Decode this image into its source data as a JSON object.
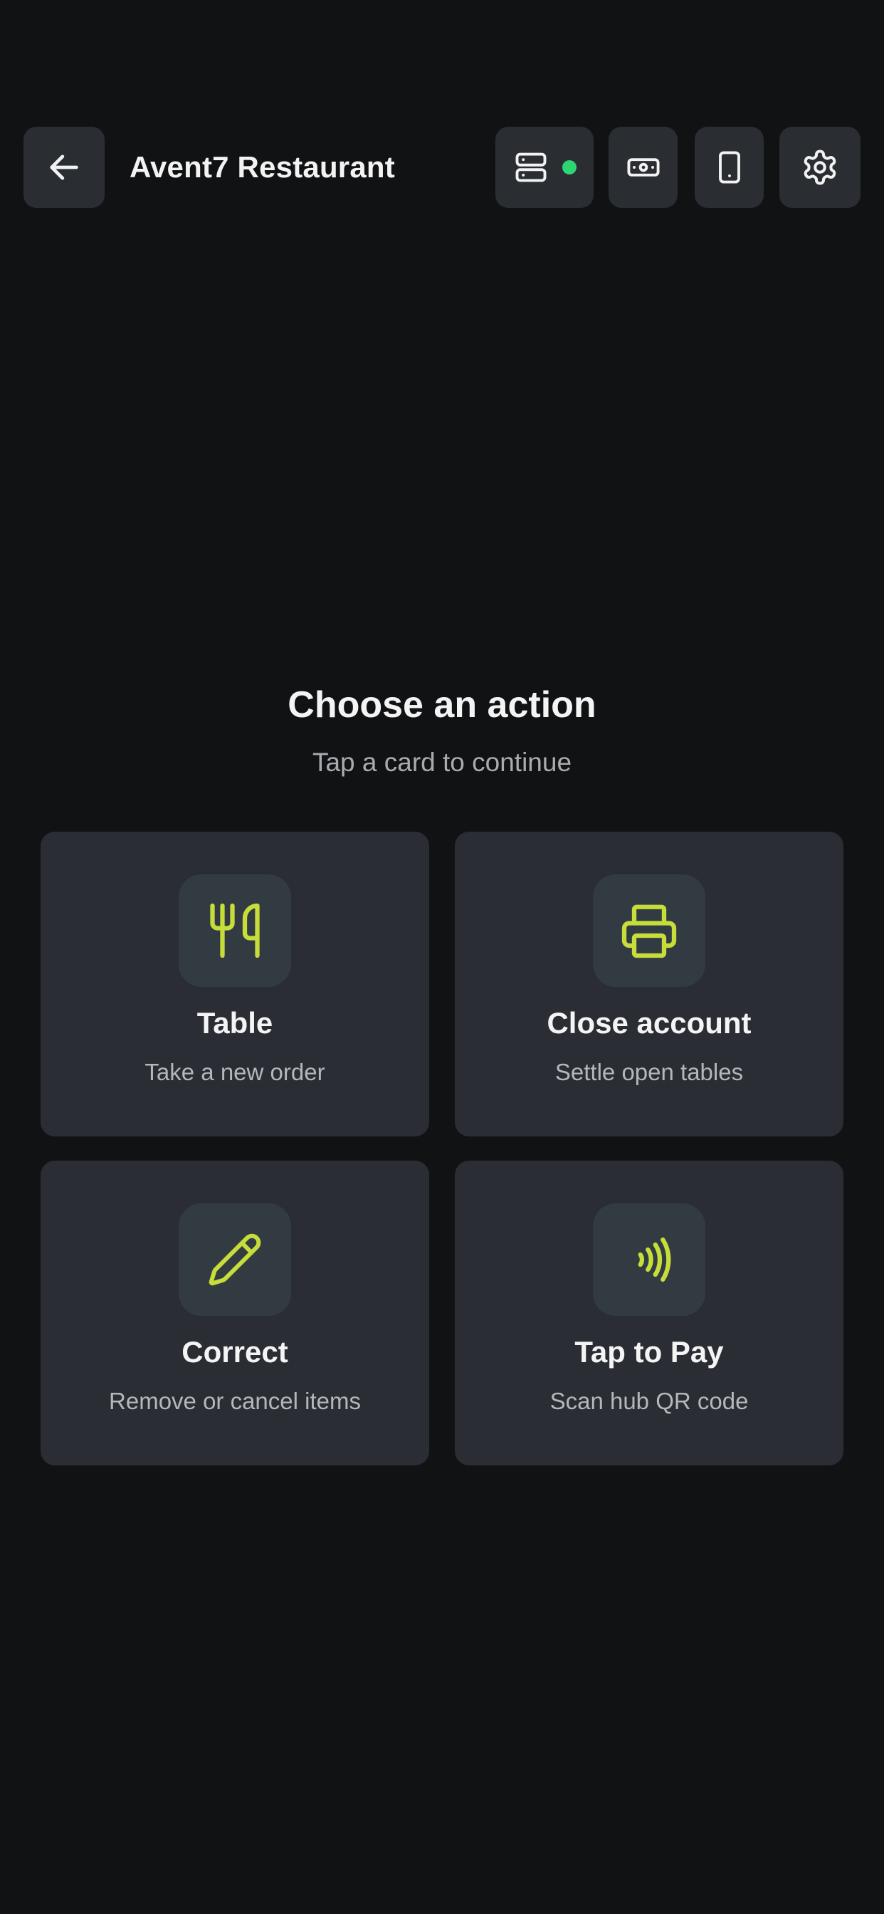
{
  "header": {
    "title": "Avent7 Restaurant",
    "server_status": "online",
    "status_color": "#2ed573",
    "icons": [
      "arrow-left-icon",
      "server-icon",
      "cash-icon",
      "smartphone-icon",
      "gear-icon"
    ]
  },
  "main": {
    "heading": "Choose an action",
    "subheading": "Tap a card to continue"
  },
  "cards": [
    {
      "title": "Table",
      "subtitle": "Take a new order",
      "icon": "fork-knife-icon"
    },
    {
      "title": "Close account",
      "subtitle": "Settle open tables",
      "icon": "printer-icon"
    },
    {
      "title": "Correct",
      "subtitle": "Remove or cancel items",
      "icon": "pencil-icon"
    },
    {
      "title": "Tap to Pay",
      "subtitle": "Scan hub QR code",
      "icon": "contactless-icon"
    }
  ],
  "colors": {
    "background": "#111214",
    "surface": "#2a2d33",
    "icon_tile": "#333b42",
    "accent": "#c6dd3a",
    "text_primary": "#f4f4f4",
    "text_secondary": "#a8abb0"
  }
}
